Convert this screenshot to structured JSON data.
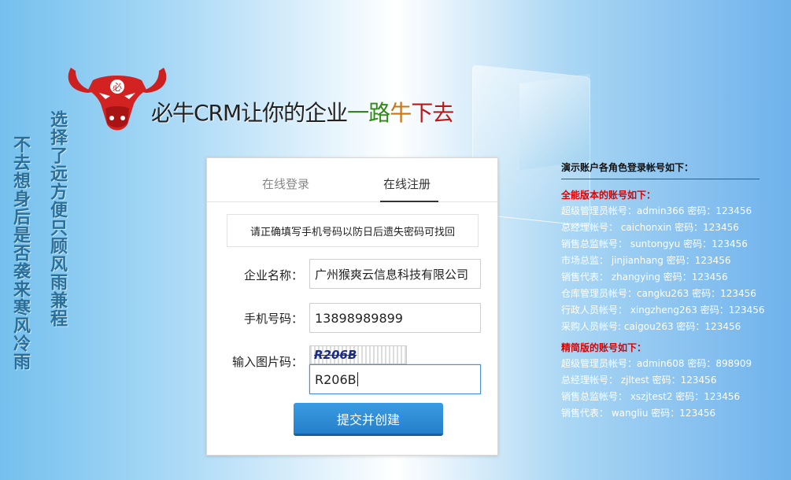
{
  "vertical_text": {
    "line1": "不去想身后是否袭来寒风冷雨",
    "line2": "选择了远方便只顾风雨兼程"
  },
  "brand": {
    "logo_letter": "必",
    "slogan_part1": "必牛CRM让你的企业",
    "slogan_part2": "一路",
    "slogan_part3": "牛",
    "slogan_part4": "下去",
    "colors": {
      "horns": "#cc1f1f",
      "green": "#2f8a16",
      "orange": "#c97612",
      "red": "#b81a1a"
    }
  },
  "form": {
    "tabs": [
      {
        "label": "在线登录",
        "active": false
      },
      {
        "label": "在线注册",
        "active": true
      }
    ],
    "notice": "请正确填写手机号码以防日后遗失密码可找回",
    "company_label": "企业名称：",
    "company_value": "广州猴爽云信息科技有限公司",
    "phone_label": "手机号码：",
    "phone_value": "13898989899",
    "captcha_label": "输入图片码：",
    "captcha_image_text": "R206B",
    "captcha_value": "R206B",
    "submit_label": "提交并创建",
    "accent_color": "#2b8ad6"
  },
  "accounts": {
    "title": "演示账户各角色登录帐号如下：",
    "sections": [
      {
        "heading": "全能版本的账号如下：",
        "lines": [
          "超级管理员帐号：admin366 密码：123456",
          "总经理帐号： caichonxin 密码：123456",
          "销售总监帐号： suntongyu 密码：123456",
          "市场总监： jinjianhang 密码：123456",
          "销售代表： zhangying 密码：123456",
          "仓库管理员帐号：cangku263 密码：123456",
          "行政人员帐号： xingzheng263 密码：123456",
          "采购人员帐号: caigou263 密码：123456"
        ]
      },
      {
        "heading": "精简版的账号如下：",
        "lines": [
          "超级管理员帐号：admin608 密码：898909",
          "总经理帐号： zjltest 密码：123456",
          "销售总监帐号： xszjtest2 密码：123456",
          "销售代表： wangliu 密码：123456"
        ]
      }
    ]
  }
}
